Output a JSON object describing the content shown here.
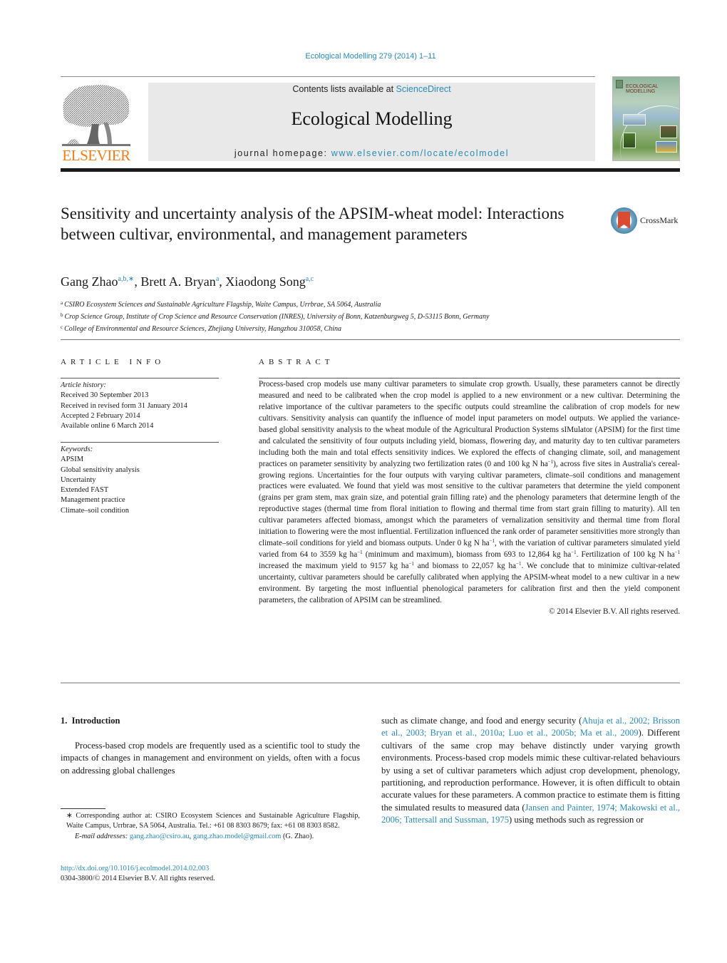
{
  "header": {
    "journal_ref": "Ecological Modelling 279 (2014) 1–11",
    "contents_prefix": "Contents lists available at ",
    "contents_link": "ScienceDirect",
    "journal_title": "Ecological Modelling",
    "homepage_prefix": "journal homepage: ",
    "homepage_link": "www.elsevier.com/locate/ecolmodel",
    "publisher_logo_text": "ELSEVIER",
    "cover_title_line1": "ECOLOGICAL",
    "cover_title_line2": "MODELLING"
  },
  "article": {
    "title": "Sensitivity and uncertainty analysis of the APSIM-wheat model: Interactions between cultivar, environmental, and management parameters",
    "crossmark_label": "CrossMark",
    "authors": [
      {
        "name": "Gang Zhao",
        "sup": "a,b,∗"
      },
      {
        "name": "Brett A. Bryan",
        "sup": "a"
      },
      {
        "name": "Xiaodong Song",
        "sup": "a,c"
      }
    ],
    "affiliations": [
      {
        "key": "a",
        "text": "CSIRO Ecosystem Sciences and Sustainable Agriculture Flagship, Waite Campus, Urrbrae, SA 5064, Australia"
      },
      {
        "key": "b",
        "text": "Crop Science Group, Institute of Crop Science and Resource Conservation (INRES), University of Bonn, Katzenburgweg 5, D-53115 Bonn, Germany"
      },
      {
        "key": "c",
        "text": "College of Environmental and Resource Sciences, Zhejiang University, Hangzhou 310058, China"
      }
    ]
  },
  "article_info": {
    "label": "ARTICLE INFO",
    "history_head": "Article history:",
    "history": [
      "Received 30 September 2013",
      "Received in revised form 31 January 2014",
      "Accepted 2 February 2014",
      "Available online 6 March 2014"
    ],
    "keywords_head": "Keywords:",
    "keywords": [
      "APSIM",
      "Global sensitivity analysis",
      "Uncertainty",
      "Extended FAST",
      "Management practice",
      "Climate–soil condition"
    ]
  },
  "abstract": {
    "label": "ABSTRACT",
    "p1": "Process-based crop models use many cultivar parameters to simulate crop growth. Usually, these parameters cannot be directly measured and need to be calibrated when the crop model is applied to a new environment or a new cultivar. Determining the relative importance of the cultivar parameters to the specific outputs could streamline the calibration of crop models for new cultivars. Sensitivity analysis can quantify the influence of model input parameters on model outputs. We applied the variance-based global sensitivity analysis to the wheat module of the Agricultural Production Systems sIMulator (APSIM) for the first time and calculated the sensitivity of four outputs including yield, biomass, flowering day, and maturity day to ten cultivar parameters including both the main and total effects sensitivity indices. We explored the effects of changing climate, soil, and management practices on parameter sensitivity by analyzing two fertilization rates (0 and 100 kg N ha",
    "p2": "), across five sites in Australia's cereal-growing regions. Uncertainties for the four outputs with varying cultivar parameters, climate–soil conditions and management practices were evaluated. We found that yield was most sensitive to the cultivar parameters that determine the yield component (grains per gram stem, max grain size, and potential grain filling rate) and the phenology parameters that determine length of the reproductive stages (thermal time from floral initiation to flowing and thermal time from start grain filling to maturity). All ten cultivar parameters affected biomass, amongst which the parameters of vernalization sensitivity and thermal time from floral initiation to flowering were the most influential. Fertilization influenced the rank order of parameter sensitivities more strongly than climate–soil conditions for yield and biomass outputs. Under 0 kg N ha",
    "p3": ", with the variation of cultivar parameters simulated yield varied from 64 to 3559 kg ha",
    "p4": " (minimum and maximum), biomass from 693 to 12,864 kg ha",
    "p5": ". Fertilization of 100 kg N ha",
    "p6": " increased the maximum yield to 9157 kg ha",
    "p7": " and biomass to 22,057 kg ha",
    "p8": ". We conclude that to minimize cultivar-related uncertainty, cultivar parameters should be carefully calibrated when applying the APSIM-wheat model to a new cultivar in a new environment. By targeting the most influential phenological parameters for calibration first and then the yield component parameters, the calibration of APSIM can be streamlined.",
    "exponent": "−1",
    "copyright": "© 2014 Elsevier B.V. All rights reserved."
  },
  "introduction": {
    "heading": "1.  Introduction",
    "left_text": "Process-based crop models are frequently used as a scientific tool to study the impacts of changes in management and environment on yields, often with a focus on addressing global challenges",
    "right_text_1": "such as climate change, and food and energy security (",
    "citations_1": "Ahuja et al., 2002; Brisson et al., 2003; Bryan et al., 2010a; Luo et al., 2005b; Ma et al., 2009",
    "right_text_2": "). Different cultivars of the same crop may behave distinctly under varying growth environments. Process-based crop models mimic these cultivar-related behaviours by using a set of cultivar parameters which adjust crop development, phenology, partitioning, and reproduction performance. However, it is often difficult to obtain accurate values for these parameters. A common practice to estimate them is fitting the simulated results to measured data (",
    "citations_2": "Jansen and Painter, 1974; Makowski et al., 2006; Tattersall and Sussman, 1975",
    "right_text_3": ") using methods such as regression or"
  },
  "footnotes": {
    "corresponding": "∗  Corresponding author at: CSIRO Ecosystem Sciences and Sustainable Agriculture Flagship, Waite Campus, Urrbrae, SA 5064, Australia. Tel.: +61 08 8303 8679; fax: +61 08 8303 8582.",
    "email_label": "E-mail addresses: ",
    "email_1": "gang.zhao@csiro.au",
    "email_sep": ", ",
    "email_2": "gang.zhao.model@gmail.com",
    "email_suffix": " (G. Zhao).",
    "doi": "http://dx.doi.org/10.1016/j.ecolmodel.2014.02.003",
    "issn_copyright": "0304-3800/© 2014 Elsevier B.V. All rights reserved."
  }
}
